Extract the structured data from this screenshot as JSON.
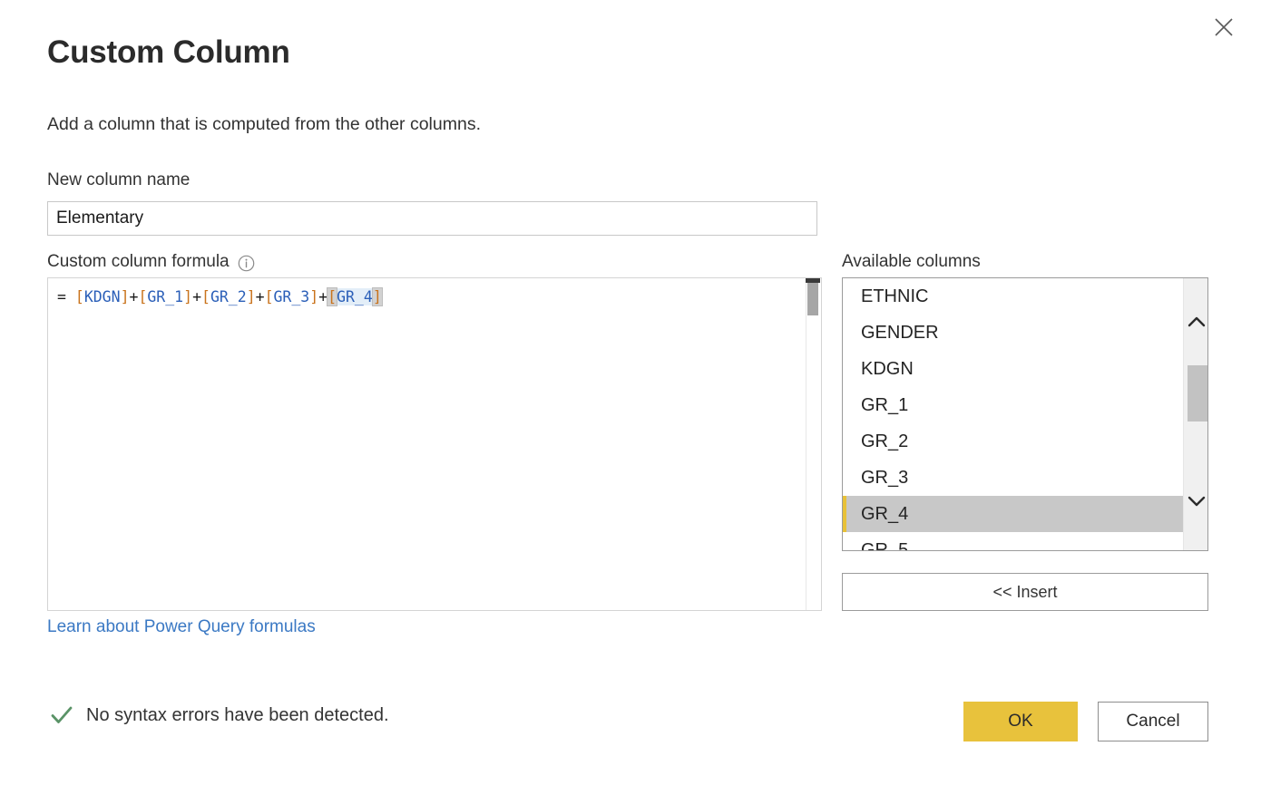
{
  "dialog": {
    "title": "Custom Column",
    "description": "Add a column that is computed from the other columns.",
    "close_icon": "close-icon"
  },
  "new_column": {
    "label": "New column name",
    "value": "Elementary",
    "placeholder": ""
  },
  "formula": {
    "label": "Custom column formula",
    "info_icon": "info-icon",
    "text": "= [KDGN]+[GR_1]+[GR_2]+[GR_3]+[GR_4]",
    "tokens": [
      {
        "t": "= ",
        "k": "eq"
      },
      {
        "t": "[",
        "k": "brk"
      },
      {
        "t": "KDGN",
        "k": "ident"
      },
      {
        "t": "]",
        "k": "brk"
      },
      {
        "t": "+",
        "k": "op"
      },
      {
        "t": "[",
        "k": "brk"
      },
      {
        "t": "GR_1",
        "k": "ident"
      },
      {
        "t": "]",
        "k": "brk"
      },
      {
        "t": "+",
        "k": "op"
      },
      {
        "t": "[",
        "k": "brk"
      },
      {
        "t": "GR_2",
        "k": "ident"
      },
      {
        "t": "]",
        "k": "brk"
      },
      {
        "t": "+",
        "k": "op"
      },
      {
        "t": "[",
        "k": "brk"
      },
      {
        "t": "GR_3",
        "k": "ident"
      },
      {
        "t": "]",
        "k": "brk"
      },
      {
        "t": "+",
        "k": "op"
      },
      {
        "t": "[",
        "k": "brk",
        "match": true,
        "sel": true
      },
      {
        "t": "GR_4",
        "k": "ident",
        "sel": true
      },
      {
        "t": "]",
        "k": "brk",
        "match": true,
        "sel": true
      }
    ],
    "selected_text": "[GR_4]"
  },
  "available_columns": {
    "label": "Available columns",
    "items": [
      {
        "name": "ETHNIC",
        "selected": false
      },
      {
        "name": "GENDER",
        "selected": false
      },
      {
        "name": "KDGN",
        "selected": false
      },
      {
        "name": "GR_1",
        "selected": false
      },
      {
        "name": "GR_2",
        "selected": false
      },
      {
        "name": "GR_3",
        "selected": false
      },
      {
        "name": "GR_4",
        "selected": true
      },
      {
        "name": "GR_5",
        "selected": false
      }
    ],
    "selected_value": "GR_4",
    "scroll_up_icon": "chevron-up-icon",
    "scroll_down_icon": "chevron-down-icon"
  },
  "insert_button": {
    "label": "<< Insert"
  },
  "learn_link": {
    "label": "Learn about Power Query formulas"
  },
  "status": {
    "icon": "checkmark-icon",
    "text": "No syntax errors have been detected."
  },
  "footer": {
    "ok_label": "OK",
    "cancel_label": "Cancel"
  },
  "colors": {
    "accent": "#e8c23c",
    "link": "#3b79c4",
    "success": "#5a9367",
    "selection_row": "#c8c8c8",
    "selection_bar": "#e8c138",
    "formula_bracket": "#c9731c",
    "formula_identifier": "#2b5fb8",
    "formula_selection": "#e3eef8"
  }
}
